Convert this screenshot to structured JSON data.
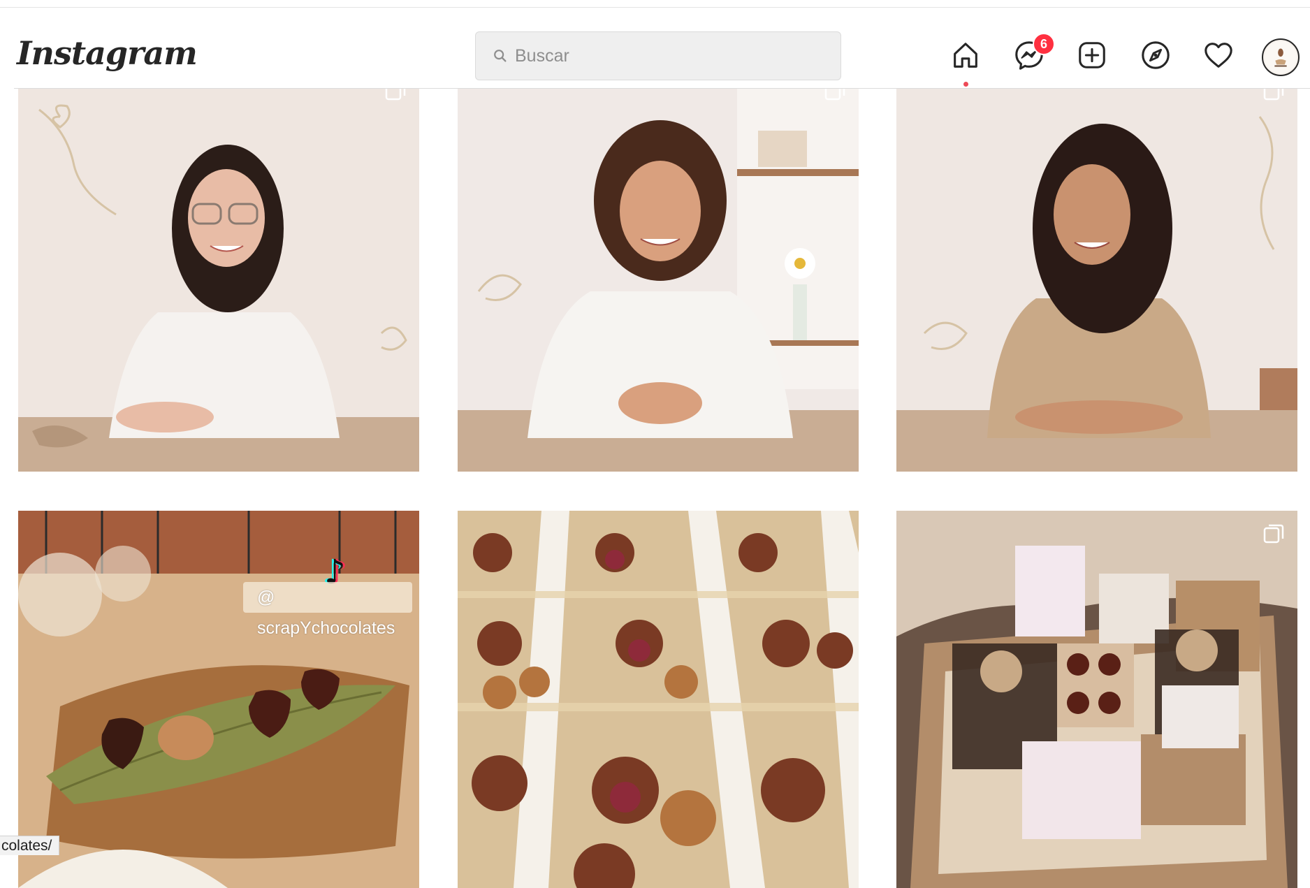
{
  "app": {
    "name": "Instagram"
  },
  "header": {
    "logo_text": "Instagram",
    "search": {
      "placeholder": "Buscar",
      "icon": "search-icon"
    },
    "nav": [
      {
        "name": "home",
        "icon": "home-icon",
        "active": true
      },
      {
        "name": "messenger",
        "icon": "messenger-icon",
        "badge": "6"
      },
      {
        "name": "new-post",
        "icon": "plus-square-icon"
      },
      {
        "name": "explore",
        "icon": "compass-icon"
      },
      {
        "name": "activity",
        "icon": "heart-icon"
      },
      {
        "name": "profile",
        "icon": "avatar"
      }
    ],
    "messenger_badge": "6"
  },
  "grid": {
    "posts": [
      {
        "subject": "woman-glasses-portrait",
        "multi": true
      },
      {
        "subject": "woman-curly-hair-portrait",
        "multi": true
      },
      {
        "subject": "woman-beige-polo-portrait",
        "multi": true
      },
      {
        "subject": "chocolates-on-leaf",
        "multi": false,
        "overlay_text": "@ scrapYchocolates"
      },
      {
        "subject": "chocolate-box-assortment",
        "multi": false
      },
      {
        "subject": "gift-box-pack",
        "multi": true
      }
    ]
  },
  "status_bar": {
    "url_fragment": "colates/"
  },
  "colors": {
    "badge": "#ff3040",
    "active_dot": "#ed4956",
    "border": "#dbdbdb",
    "text": "#262626"
  }
}
